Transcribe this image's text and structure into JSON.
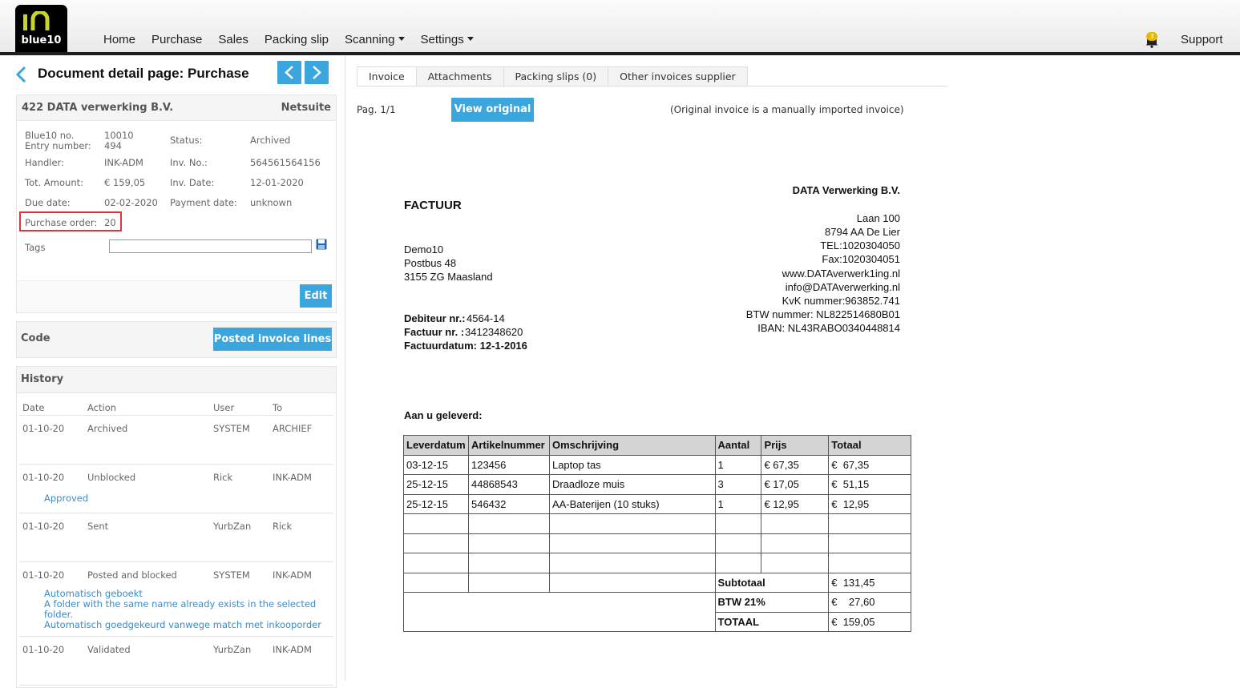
{
  "app": {
    "logo_text": "blue10",
    "nav": [
      "Home",
      "Purchase",
      "Sales",
      "Packing slip",
      "Scanning",
      "Settings"
    ],
    "notification_count": "3",
    "support": "Support"
  },
  "page": {
    "title": "Document detail page: Purchase"
  },
  "details": {
    "supplier": "422 DATA verwerking B.V.",
    "system": "Netsuite",
    "blue10_no_label": "Blue10 no.",
    "blue10_no": "10010",
    "entry_number_label": "Entry number:",
    "entry_number": "494",
    "status_label": "Status:",
    "status": "Archived",
    "handler_label": "Handler:",
    "handler": "INK-ADM",
    "inv_no_label": "Inv. No.:",
    "inv_no": "564561564156",
    "tot_amount_label": "Tot. Amount:",
    "tot_amount": "€ 159,05",
    "inv_date_label": "Inv. Date:",
    "inv_date": "12-01-2020",
    "due_date_label": "Due date:",
    "due_date": "02-02-2020",
    "payment_date_label": "Payment date:",
    "payment_date": "unknown",
    "purchase_order_label": "Purchase order:",
    "purchase_order": "20",
    "tags_label": "Tags",
    "tags_value": "",
    "edit_label": "Edit"
  },
  "code": {
    "label": "Code",
    "posted_label": "Posted invoice lines"
  },
  "history": {
    "title": "History",
    "columns": [
      "Date",
      "Action",
      "User",
      "To"
    ],
    "rows": [
      {
        "date": "01-10-20",
        "action": "Archived",
        "user": "SYSTEM",
        "to": "ARCHIEF",
        "notes": []
      },
      {
        "date": "01-10-20",
        "action": "Unblocked",
        "user": "Rick",
        "to": "INK-ADM",
        "notes": [
          "Approved"
        ]
      },
      {
        "date": "01-10-20",
        "action": "Sent",
        "user": "YurbZan",
        "to": "Rick",
        "notes": []
      },
      {
        "date": "01-10-20",
        "action": "Posted and blocked",
        "user": "SYSTEM",
        "to": "INK-ADM",
        "notes": [
          "Automatisch geboekt",
          "A folder with the same name already exists in the selected",
          "folder.",
          "Automatisch goedgekeurd vanwege match met inkooporder"
        ]
      },
      {
        "date": "01-10-20",
        "action": "Validated",
        "user": "YurbZan",
        "to": "INK-ADM",
        "notes": []
      }
    ]
  },
  "tabs": [
    "Invoice",
    "Attachments",
    "Packing slips (0)",
    "Other invoices supplier"
  ],
  "viewer": {
    "page": "Pag. 1/1",
    "view_original": "View original",
    "note": "(Original invoice is a manually imported invoice)"
  },
  "invoice": {
    "title": "FACTUUR",
    "sender": [
      "DATA Verwerking B.V.",
      "Laan 100",
      "8794 AA De Lier",
      "TEL:1020304050",
      "Fax:1020304051",
      "www.DATAverwerk1ing.nl",
      "info@DATAverwerking.nl",
      "KvK nummer:963852.741",
      "BTW nummer: NL822514680B01",
      "IBAN: NL43RABO0340448814"
    ],
    "recipient": [
      "Demo10",
      "Postbus 48",
      "3155 ZG Maasland"
    ],
    "debiteur_label": "Debiteur nr.:",
    "debiteur": "4564-14",
    "factuur_label": "Factuur nr. :",
    "factuur": "3412348620",
    "factuurdatum": "Factuurdatum: 12-1-2016",
    "delivered": "Aan u geleverd:",
    "columns": [
      "Leverdatum",
      "Artikelnummer",
      "Omschrijving",
      "Aantal",
      "Prijs",
      "Totaal"
    ],
    "rows": [
      [
        "03-12-15",
        "123456",
        "Laptop tas",
        "1",
        "€ 67,35",
        "€  67,35"
      ],
      [
        "25-12-15",
        "44868543",
        "Draadloze muis",
        "3",
        "€ 17,05",
        "€  51,15"
      ],
      [
        "25-12-15",
        "546432",
        "AA-Baterijen (10 stuks)",
        "1",
        "€ 12,95",
        "€  12,95"
      ]
    ],
    "subtotal_label": "Subtotaal",
    "subtotal": "€  131,45",
    "btw_label": "BTW 21%",
    "btw": "€    27,60",
    "total_label": "TOTAAL",
    "total": "€  159,05"
  }
}
